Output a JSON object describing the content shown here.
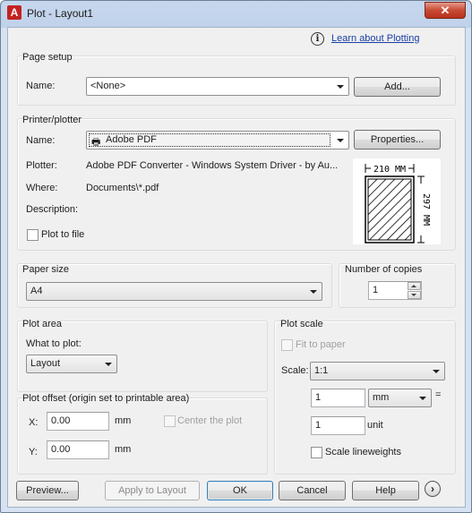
{
  "window": {
    "title": "Plot - Layout1",
    "close_glyph": "✕"
  },
  "help": {
    "link_text": "Learn about Plotting",
    "icon": "info-icon"
  },
  "page_setup": {
    "label": "Page setup",
    "name_label": "Name:",
    "name_value": "<None>",
    "add_button": "Add..."
  },
  "printer": {
    "label": "Printer/plotter",
    "name_label": "Name:",
    "name_value": "Adobe PDF",
    "properties_button": "Properties...",
    "plotter_label": "Plotter:",
    "plotter_value": "Adobe PDF Converter - Windows System Driver - by Au...",
    "where_label": "Where:",
    "where_value": "Documents\\*.pdf",
    "description_label": "Description:",
    "plot_to_file_label": "Plot to file",
    "plot_to_file_checked": false,
    "preview": {
      "width_text": "210 MM",
      "height_text": "297 MM"
    }
  },
  "paper_size": {
    "label": "Paper size",
    "value": "A4"
  },
  "copies": {
    "label": "Number of copies",
    "value": "1"
  },
  "plot_area": {
    "label": "Plot area",
    "what_label": "What to plot:",
    "what_value": "Layout"
  },
  "plot_scale": {
    "label": "Plot scale",
    "fit_to_paper_label": "Fit to paper",
    "fit_to_paper_checked": false,
    "scale_label": "Scale:",
    "scale_value": "1:1",
    "value1": "1",
    "unit1": "mm",
    "equals": "=",
    "value2": "1",
    "unit2": "unit",
    "scale_lineweights_label": "Scale lineweights",
    "scale_lineweights_checked": false
  },
  "plot_offset": {
    "label": "Plot offset (origin set to printable area)",
    "x_label": "X:",
    "x_value": "0.00",
    "x_unit": "mm",
    "y_label": "Y:",
    "y_value": "0.00",
    "y_unit": "mm",
    "center_label": "Center the plot",
    "center_checked": false
  },
  "footer": {
    "preview": "Preview...",
    "apply": "Apply to Layout",
    "ok": "OK",
    "cancel": "Cancel",
    "help": "Help",
    "expand_glyph": "›"
  }
}
